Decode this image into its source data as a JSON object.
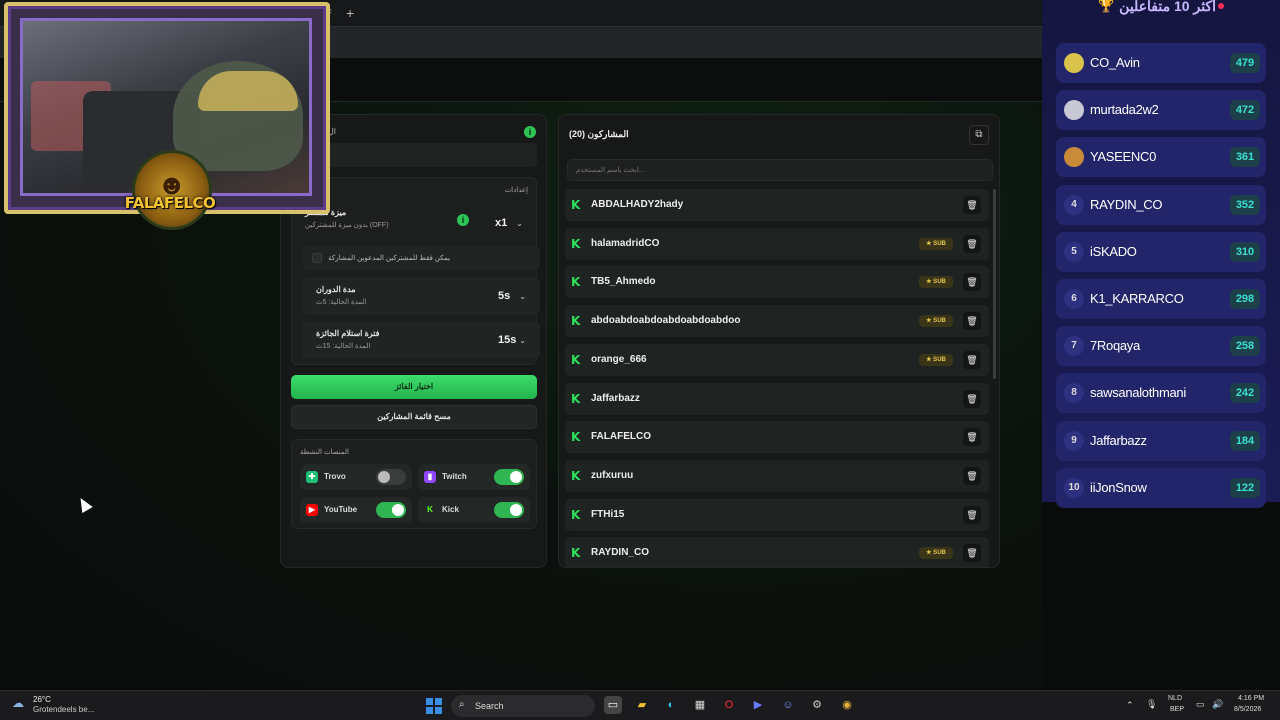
{
  "browser": {
    "new_tab_symbol": "+",
    "tab_close_symbol": "×"
  },
  "settings": {
    "title": "ال",
    "info_symbol": "i",
    "group_label": "إعدادات",
    "multiplier": {
      "title": "ميزة للمشتر",
      "sub": "بدون ميزة للمشتركين (OFF)",
      "value": "x1"
    },
    "subs_only_label": "يمكن فقط للمشتركين المدعوين المشاركة",
    "spin_duration": {
      "title": "مدة الدوران",
      "sub": "المدة الحالية: 5ث",
      "value": "5s"
    },
    "claim_period": {
      "title": "فترة استلام الجائزة",
      "sub": "المدة الحالية: 15ث",
      "value": "15s"
    },
    "pick_winner_label": "اختيار الفائز",
    "clear_list_label": "مسح قائمة المشاركين",
    "platforms_label": "المنصات النشطة",
    "platforms": [
      {
        "name": "Trovo",
        "enabled": false,
        "color": "#1fbf77",
        "icon": "trovo-icon"
      },
      {
        "name": "Twitch",
        "enabled": true,
        "color": "#9146ff",
        "icon": "twitch-icon"
      },
      {
        "name": "YouTube",
        "enabled": true,
        "color": "#ff0000",
        "icon": "youtube-icon"
      },
      {
        "name": "Kick",
        "enabled": true,
        "color": "#53fc18",
        "icon": "kick-icon"
      }
    ]
  },
  "participants": {
    "title": "المشاركون (20)",
    "search_placeholder": "ابحث باسم المستخدم...",
    "sub_badge": "★ SUB",
    "items": [
      {
        "name": "ABDALHADY2hady",
        "sub": false
      },
      {
        "name": "halamadridCO",
        "sub": true
      },
      {
        "name": "TB5_Ahmedo",
        "sub": true
      },
      {
        "name": "abdoabdoabdoabdoabdoabdoo",
        "sub": true
      },
      {
        "name": "orange_666",
        "sub": true
      },
      {
        "name": "Jaffarbazz",
        "sub": false
      },
      {
        "name": "FALAFELCO",
        "sub": false
      },
      {
        "name": "zufxuruu",
        "sub": false
      },
      {
        "name": "FTHi15",
        "sub": false
      },
      {
        "name": "RAYDIN_CO",
        "sub": true
      }
    ]
  },
  "leaderboard": {
    "title": "أكثر 10 متفاعلين",
    "items": [
      {
        "rank": "",
        "name": "CO_Avin",
        "score": "479"
      },
      {
        "rank": "",
        "name": "murtada2w2",
        "score": "472"
      },
      {
        "rank": "",
        "name": "YASEENC0",
        "score": "361"
      },
      {
        "rank": "4",
        "name": "RAYDIN_CO",
        "score": "352"
      },
      {
        "rank": "5",
        "name": "iSKADO",
        "score": "310"
      },
      {
        "rank": "6",
        "name": "K1_KARRARCO",
        "score": "298"
      },
      {
        "rank": "7",
        "name": "7Roqaya",
        "score": "258"
      },
      {
        "rank": "8",
        "name": "sawsanalothmani",
        "score": "242"
      },
      {
        "rank": "9",
        "name": "Jaffarbazz",
        "score": "184"
      },
      {
        "rank": "10",
        "name": "iiJonSnow",
        "score": "122"
      }
    ]
  },
  "webcam": {
    "logo_text": "FALAFELCO"
  },
  "taskbar": {
    "temp": "26°C",
    "weather_desc": "Grotendeels be...",
    "search_label": "Search",
    "lang": "NLD",
    "lang_sub": "BEP",
    "time": "4:16 PM",
    "date": "8/5/2026"
  }
}
